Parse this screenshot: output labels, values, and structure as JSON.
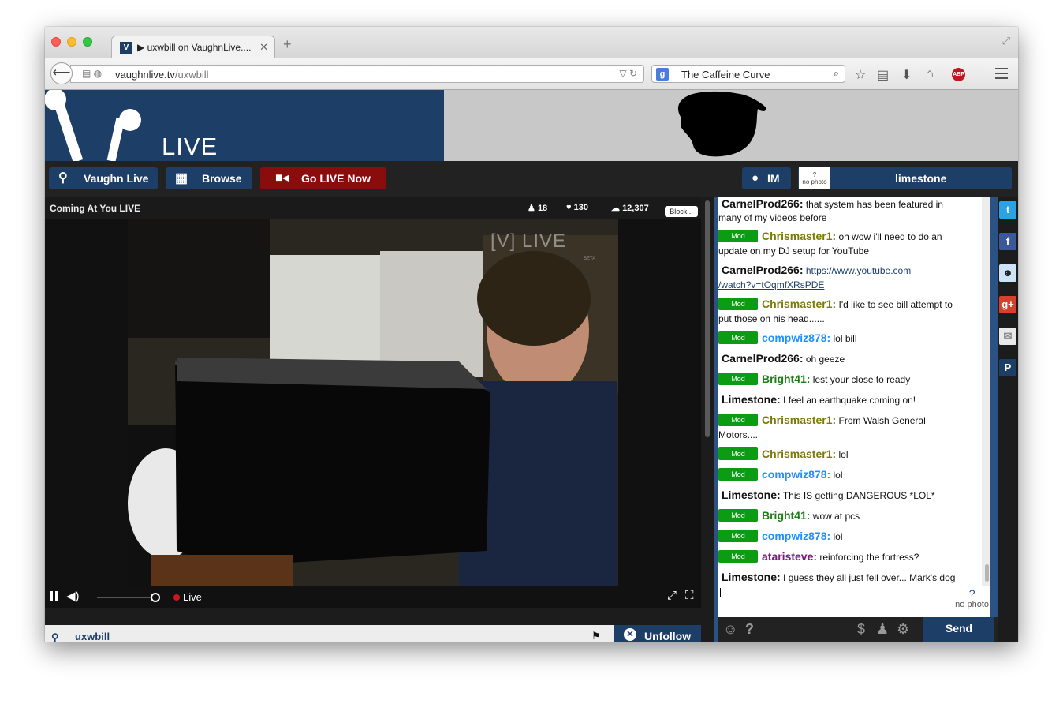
{
  "browser": {
    "tab_title": "▶ uxwbill on VaughnLive....",
    "tab_favicon": "V",
    "new_tab": "+",
    "url_domain": "vaughnlive.tv",
    "url_path": "/uxwbill",
    "search_text": "The Caffeine Curve",
    "search_engine_icon": "g",
    "abp_label": "ABP"
  },
  "site": {
    "logo_text": "LIVE",
    "nav": {
      "vaughn_live": "Vaughn Live",
      "browse": "Browse",
      "go_live": "Go LIVE Now",
      "im": "IM",
      "username": "limestone",
      "nophoto": "no photo"
    }
  },
  "player": {
    "stream_title": "Coming At You LIVE",
    "viewers": "18",
    "likes": "130",
    "views": "12,307",
    "block_label": "Block...",
    "watermark": "[V] LIVE",
    "watermark_sub": "BETA",
    "live_label": "Live",
    "volume_level": 0.95,
    "channel_name": "uxwbill",
    "unfollow_label": "Unfollow"
  },
  "chat": {
    "messages": [
      {
        "mod": false,
        "user": "CarnelProd266:",
        "text": "that system has been featured in",
        "text2": "many of my videos before"
      },
      {
        "mod": true,
        "user": "Chrismaster1:",
        "text": "oh wow i'll need to do an",
        "text2": "update on my DJ setup for YouTube"
      },
      {
        "mod": false,
        "user": "CarnelProd266:",
        "text": "https://www.youtube.com",
        "text2": "/watch?v=tOqmfXRsPDE"
      },
      {
        "mod": true,
        "user": "Chrismaster1:",
        "text": "I'd like to see bill attempt to",
        "text2": "put those on his head......"
      },
      {
        "mod": true,
        "user": "compwiz878:",
        "text": "lol bill"
      },
      {
        "mod": false,
        "user": "CarnelProd266:",
        "text": "oh geeze"
      },
      {
        "mod": true,
        "user": "Bright41:",
        "text": "lest your close to ready"
      },
      {
        "mod": false,
        "user": "Limestone:",
        "text": "I feel an earthquake coming on!"
      },
      {
        "mod": true,
        "user": "Chrismaster1:",
        "text": "From Walsh General",
        "text2": "Motors...."
      },
      {
        "mod": true,
        "user": "Chrismaster1:",
        "text": "lol"
      },
      {
        "mod": true,
        "user": "compwiz878:",
        "text": "lol"
      },
      {
        "mod": false,
        "user": "Limestone:",
        "text": "This IS getting DANGEROUS *LOL*"
      },
      {
        "mod": true,
        "user": "Bright41:",
        "text": "wow at pcs"
      },
      {
        "mod": true,
        "user": "compwiz878:",
        "text": "lol"
      },
      {
        "mod": true,
        "user": "ataristeve:",
        "text": "reinforcing the fortress?"
      },
      {
        "mod": false,
        "user": "Limestone:",
        "text": "I guess they all just fell over... Mark's dog"
      }
    ],
    "mod_label": "Mod",
    "send_label": "Send",
    "input_nophoto": "no photo"
  },
  "colors": {
    "brand_blue": "#1d3e66",
    "golive_red": "#8a0c0c",
    "mod_green": "#0c9c14"
  }
}
